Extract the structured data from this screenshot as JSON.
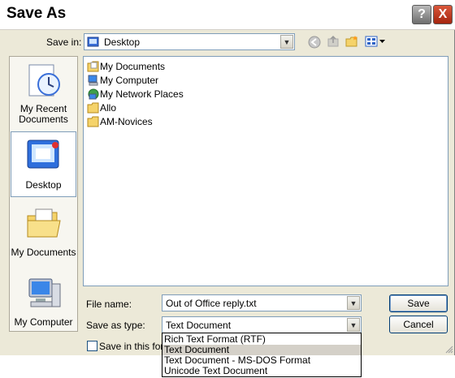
{
  "window": {
    "title": "Save As",
    "help_glyph": "?",
    "close_glyph": "X"
  },
  "toolbar": {
    "save_in_label": "Save in:",
    "location": "Desktop"
  },
  "places": [
    {
      "label": "My Recent\nDocuments"
    },
    {
      "label": "Desktop"
    },
    {
      "label": "My Documents"
    },
    {
      "label": "My Computer"
    }
  ],
  "files": [
    {
      "name": "My Documents",
      "icon": "my-documents-folder-icon"
    },
    {
      "name": "My Computer",
      "icon": "my-computer-icon"
    },
    {
      "name": "My Network Places",
      "icon": "network-places-icon"
    },
    {
      "name": "Allo",
      "icon": "folder-icon"
    },
    {
      "name": "AM-Novices",
      "icon": "folder-icon"
    }
  ],
  "form": {
    "file_name_label": "File name:",
    "file_name_value": "Out of Office reply.txt",
    "save_as_type_label": "Save as type:",
    "save_as_type_value": "Text Document",
    "save_button": "Save",
    "cancel_button": "Cancel",
    "checkbox_label": "Save in this form"
  },
  "type_options": [
    "Rich Text Format (RTF)",
    "Text Document",
    "Text Document - MS-DOS Format",
    "Unicode Text Document"
  ],
  "selected_type_index": 1
}
